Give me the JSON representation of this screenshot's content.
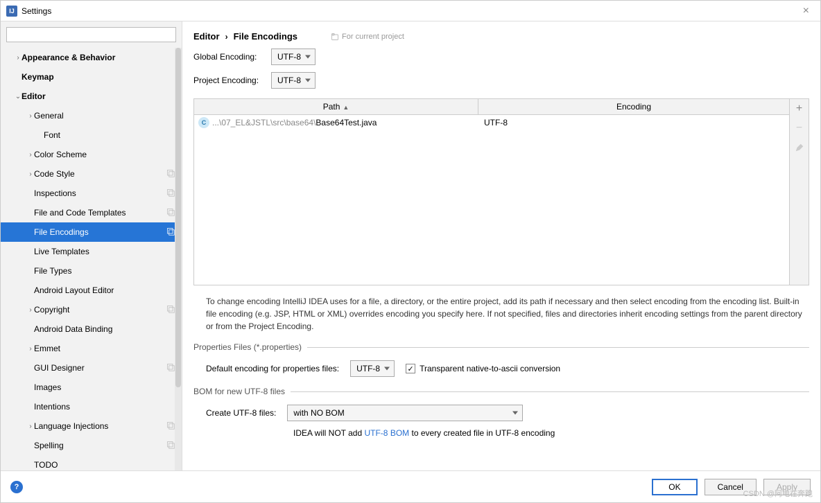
{
  "window": {
    "title": "Settings",
    "close": "×"
  },
  "search": {
    "placeholder": ""
  },
  "sidebar": {
    "items": [
      {
        "label": "Appearance & Behavior",
        "lvl": 0,
        "arrow": "›",
        "bold": true
      },
      {
        "label": "Keymap",
        "lvl": 0,
        "arrow": "",
        "bold": true
      },
      {
        "label": "Editor",
        "lvl": 0,
        "arrow": "⌄",
        "bold": true
      },
      {
        "label": "General",
        "lvl": 1,
        "arrow": "›"
      },
      {
        "label": "Font",
        "lvl": 2,
        "arrow": ""
      },
      {
        "label": "Color Scheme",
        "lvl": 1,
        "arrow": "›"
      },
      {
        "label": "Code Style",
        "lvl": 1,
        "arrow": "›",
        "badge": true
      },
      {
        "label": "Inspections",
        "lvl": 1,
        "arrow": "",
        "badge": true
      },
      {
        "label": "File and Code Templates",
        "lvl": 1,
        "arrow": "",
        "badge": true
      },
      {
        "label": "File Encodings",
        "lvl": 1,
        "arrow": "",
        "badge": true,
        "selected": true
      },
      {
        "label": "Live Templates",
        "lvl": 1,
        "arrow": ""
      },
      {
        "label": "File Types",
        "lvl": 1,
        "arrow": ""
      },
      {
        "label": "Android Layout Editor",
        "lvl": 1,
        "arrow": ""
      },
      {
        "label": "Copyright",
        "lvl": 1,
        "arrow": "›",
        "badge": true
      },
      {
        "label": "Android Data Binding",
        "lvl": 1,
        "arrow": ""
      },
      {
        "label": "Emmet",
        "lvl": 1,
        "arrow": "›"
      },
      {
        "label": "GUI Designer",
        "lvl": 1,
        "arrow": "",
        "badge": true
      },
      {
        "label": "Images",
        "lvl": 1,
        "arrow": ""
      },
      {
        "label": "Intentions",
        "lvl": 1,
        "arrow": ""
      },
      {
        "label": "Language Injections",
        "lvl": 1,
        "arrow": "›",
        "badge": true
      },
      {
        "label": "Spelling",
        "lvl": 1,
        "arrow": "",
        "badge": true
      },
      {
        "label": "TODO",
        "lvl": 1,
        "arrow": ""
      }
    ]
  },
  "breadcrumb": {
    "a": "Editor",
    "sep": "›",
    "b": "File Encodings",
    "badge": "For current project"
  },
  "global": {
    "label": "Global Encoding:",
    "value": "UTF-8"
  },
  "project": {
    "label": "Project Encoding:",
    "value": "UTF-8"
  },
  "table": {
    "headers": {
      "path": "Path",
      "enc": "Encoding"
    },
    "row": {
      "prefix": "...\\07_EL&JSTL\\src\\base64\\",
      "file": "Base64Test.java",
      "enc": "UTF-8"
    }
  },
  "help": "To change encoding IntelliJ IDEA uses for a file, a directory, or the entire project, add its path if necessary and then select encoding from the encoding list. Built-in file encoding (e.g. JSP, HTML or XML) overrides encoding you specify here. If not specified, files and directories inherit encoding settings from the parent directory or from the Project Encoding.",
  "props": {
    "section": "Properties Files (*.properties)",
    "label": "Default encoding for properties files:",
    "value": "UTF-8",
    "checkbox": "Transparent native-to-ascii conversion"
  },
  "bom": {
    "section": "BOM for new UTF-8 files",
    "label": "Create UTF-8 files:",
    "value": "with NO BOM",
    "note_a": "IDEA will NOT add ",
    "note_link": "UTF-8 BOM",
    "note_b": " to every created file in UTF-8 encoding"
  },
  "footer": {
    "ok": "OK",
    "cancel": "Cancel",
    "apply": "Apply"
  },
  "watermark": "CSDN @阿电在奔跑"
}
